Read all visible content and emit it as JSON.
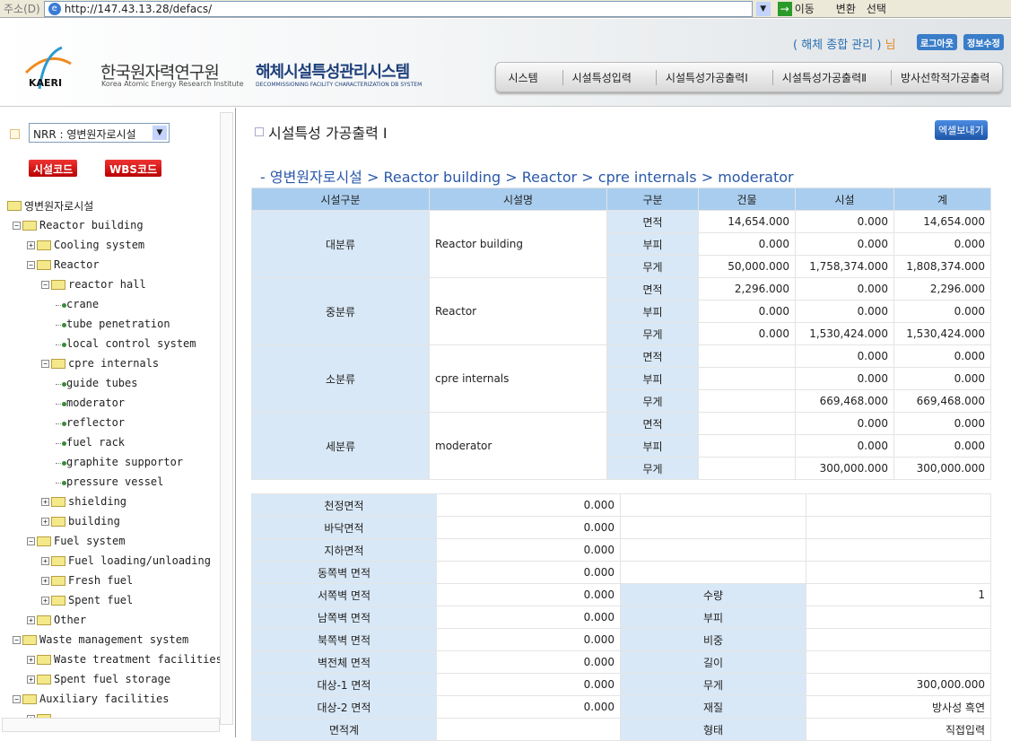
{
  "browser": {
    "address_label": "주소(D)",
    "url": "http://147.43.13.28/defacs/",
    "go_label": "이동",
    "tools": [
      "변환",
      "선택"
    ]
  },
  "header": {
    "org_ko": "한국원자력연구원",
    "org_en": "Korea Atomic Energy Research Institute",
    "logo_text": "KAERI",
    "system_ko": "해체시설특성관리시스템",
    "system_en": "DECOMMISSIONING FACILITY CHARACTERIZATION DB SYSTEM",
    "user": "( 해체 종합 관리 )",
    "user_suffix": "님",
    "logout": "로그아웃",
    "edit_info": "정보수정",
    "menu": [
      "시스템",
      "시설특성입력",
      "시설특성가공출력Ⅰ",
      "시설특성가공출력Ⅱ",
      "방사선학적가공출력"
    ]
  },
  "sidebar": {
    "select_value": "NRR : 영변원자로시설",
    "btn_facility_code": "시설코드",
    "btn_wbs_code": "WBS코드",
    "tree": [
      {
        "l": 0,
        "t": "root",
        "label": "영변원자로시설"
      },
      {
        "l": 1,
        "t": "open",
        "label": "Reactor building"
      },
      {
        "l": 2,
        "t": "closed",
        "label": "Cooling system"
      },
      {
        "l": 2,
        "t": "open",
        "label": "Reactor"
      },
      {
        "l": 3,
        "t": "open",
        "label": "reactor hall"
      },
      {
        "l": 4,
        "t": "leaf",
        "label": "crane"
      },
      {
        "l": 4,
        "t": "leaf",
        "label": "tube penetration"
      },
      {
        "l": 4,
        "t": "leaf",
        "label": "local control system"
      },
      {
        "l": 3,
        "t": "open",
        "label": "cpre internals"
      },
      {
        "l": 4,
        "t": "leaf",
        "label": "guide tubes"
      },
      {
        "l": 4,
        "t": "leaf",
        "label": "moderator"
      },
      {
        "l": 4,
        "t": "leaf",
        "label": "reflector"
      },
      {
        "l": 4,
        "t": "leaf",
        "label": "fuel rack"
      },
      {
        "l": 4,
        "t": "leaf",
        "label": "graphite supportor"
      },
      {
        "l": 4,
        "t": "leaf",
        "label": "pressure vessel"
      },
      {
        "l": 3,
        "t": "closed",
        "label": "shielding"
      },
      {
        "l": 3,
        "t": "closed",
        "label": "building"
      },
      {
        "l": 2,
        "t": "open",
        "label": "Fuel system"
      },
      {
        "l": 3,
        "t": "closed",
        "label": "Fuel loading/unloading"
      },
      {
        "l": 3,
        "t": "closed",
        "label": "Fresh fuel"
      },
      {
        "l": 3,
        "t": "closed",
        "label": "Spent fuel"
      },
      {
        "l": 2,
        "t": "closed",
        "label": "Other"
      },
      {
        "l": 1,
        "t": "open",
        "label": "Waste management system"
      },
      {
        "l": 2,
        "t": "closed",
        "label": "Waste treatment facilities"
      },
      {
        "l": 2,
        "t": "closed",
        "label": "Spent fuel storage"
      },
      {
        "l": 1,
        "t": "open",
        "label": "Auxiliary facilities"
      },
      {
        "l": 2,
        "t": "closed",
        "label": ""
      }
    ]
  },
  "main": {
    "title": "시설특성 가공출력 Ⅰ",
    "excel_button": "엑셀보내기",
    "breadcrumb": "- 영변원자로시설 > Reactor building > Reactor > cpre internals > moderator",
    "table1": {
      "headers": [
        "시설구분",
        "시설명",
        "구분",
        "건물",
        "시설",
        "계"
      ],
      "groups": [
        {
          "category": "대분류",
          "name": "Reactor building",
          "rows": [
            [
              "면적",
              "14,654.000",
              "0.000",
              "14,654.000"
            ],
            [
              "부피",
              "0.000",
              "0.000",
              "0.000"
            ],
            [
              "무게",
              "50,000.000",
              "1,758,374.000",
              "1,808,374.000"
            ]
          ]
        },
        {
          "category": "중분류",
          "name": "Reactor",
          "rows": [
            [
              "면적",
              "2,296.000",
              "0.000",
              "2,296.000"
            ],
            [
              "부피",
              "0.000",
              "0.000",
              "0.000"
            ],
            [
              "무게",
              "0.000",
              "1,530,424.000",
              "1,530,424.000"
            ]
          ]
        },
        {
          "category": "소분류",
          "name": "cpre internals",
          "rows": [
            [
              "면적",
              "",
              "0.000",
              "0.000"
            ],
            [
              "부피",
              "",
              "0.000",
              "0.000"
            ],
            [
              "무게",
              "",
              "669,468.000",
              "669,468.000"
            ]
          ]
        },
        {
          "category": "세분류",
          "name": "moderator",
          "rows": [
            [
              "면적",
              "",
              "0.000",
              "0.000"
            ],
            [
              "부피",
              "",
              "0.000",
              "0.000"
            ],
            [
              "무게",
              "",
              "300,000.000",
              "300,000.000"
            ]
          ]
        }
      ]
    },
    "table2": {
      "rows": [
        [
          "천정면적",
          "0.000",
          "",
          ""
        ],
        [
          "바닥면적",
          "0.000",
          "",
          ""
        ],
        [
          "지하면적",
          "0.000",
          "",
          ""
        ],
        [
          "동쪽벽 면적",
          "0.000",
          "",
          ""
        ],
        [
          "서쪽벽 면적",
          "0.000",
          "수량",
          "1"
        ],
        [
          "남쪽벽 면적",
          "0.000",
          "부피",
          ""
        ],
        [
          "북쪽벽 면적",
          "0.000",
          "비중",
          ""
        ],
        [
          "벽전체 면적",
          "0.000",
          "길이",
          ""
        ],
        [
          "대상-1 면적",
          "0.000",
          "무게",
          "300,000.000"
        ],
        [
          "대상-2 면적",
          "0.000",
          "재질",
          "방사성 흑연"
        ],
        [
          "면적계",
          "",
          "형태",
          "직접입력"
        ]
      ]
    }
  }
}
